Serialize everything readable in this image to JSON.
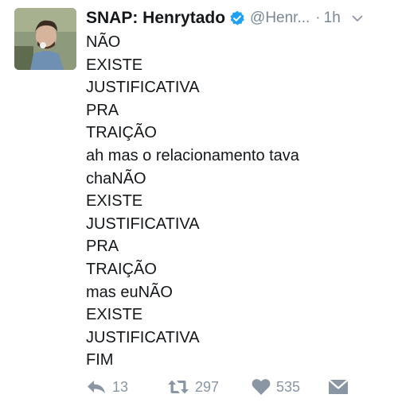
{
  "tweet": {
    "display_name": "SNAP: Henrytado",
    "handle": "@Henr...",
    "separator": "·",
    "time": "1h",
    "lines": [
      "NÃO",
      "EXISTE",
      "JUSTIFICATIVA",
      "PRA",
      "TRAIÇÃO",
      "ah mas o relacionamento tava",
      "chaNÃO",
      "EXISTE",
      "JUSTIFICATIVA",
      "PRA",
      "TRAIÇÃO",
      "mas euNÃO",
      "EXISTE",
      "JUSTIFICATIVA",
      "FIM"
    ]
  },
  "actions": {
    "reply_count": "13",
    "retweet_count": "297",
    "like_count": "535"
  },
  "icons": {
    "verified": "verified-badge-icon",
    "caret": "chevron-down-icon",
    "reply": "reply-icon",
    "retweet": "retweet-icon",
    "like": "heart-icon",
    "dm": "direct-message-icon"
  },
  "colors": {
    "text": "#14171a",
    "muted": "#7a8793",
    "action": "#8a96a3",
    "verified": "#1da1f2"
  }
}
